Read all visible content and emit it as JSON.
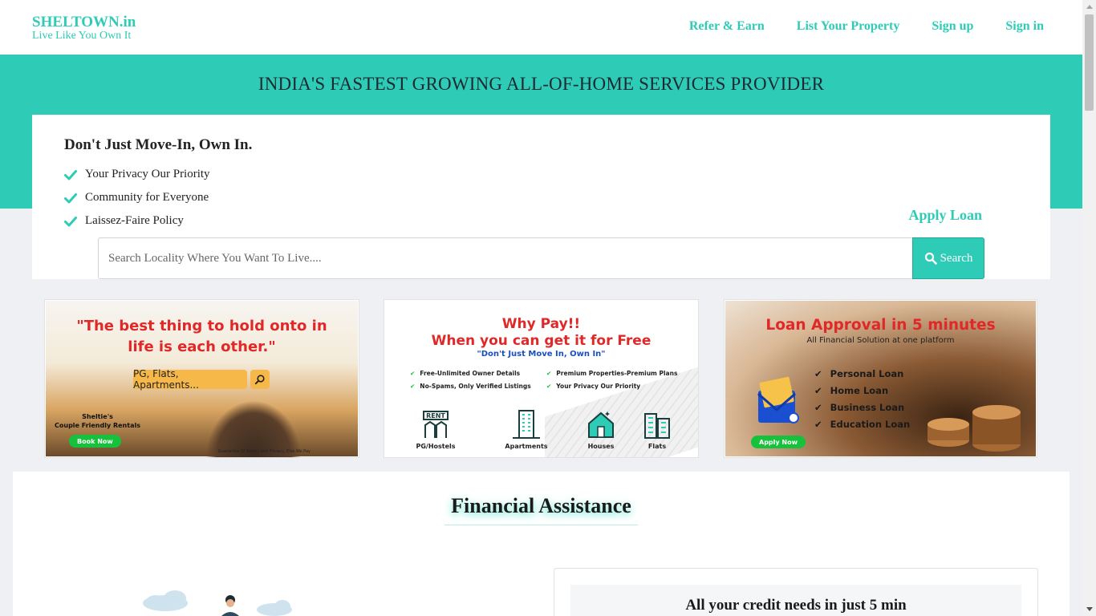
{
  "header": {
    "brand_name": "SHELTOWN.in",
    "brand_tagline": "Live Like You Own It",
    "nav": [
      "Refer & Earn",
      "List Your Property",
      "Sign up",
      "Sign in"
    ]
  },
  "band": {
    "title": "INDIA'S FASTEST GROWING ALL-OF-HOME SERVICES PROVIDER"
  },
  "hero": {
    "heading": "Don't Just Move-In, Own In.",
    "features": [
      "Your Privacy Our Priority",
      "Community for Everyone",
      "Laissez-Faire Policy"
    ],
    "apply_loan": "Apply Loan",
    "search_placeholder": "Search Locality Where You Want To Live....",
    "search_button": "Search"
  },
  "banners": {
    "couple": {
      "quote_line1": "\"The best thing to hold onto in",
      "quote_line2": "life is each other.\"",
      "pill": "PG, Flats, Apartments...",
      "small_line1": "Sheltie's",
      "small_line2": "Couple Friendly Rentals",
      "button": "Book Now",
      "fine_print": "Guarantee Of Safety and Privacy, Else We Pay"
    },
    "free": {
      "line1": "Why Pay!!",
      "line2": "When you can get it for Free",
      "sub": "\"Don't Just Move In, Own In\"",
      "left_features": [
        "Free-Unlimited Owner Details",
        "No-Spams, Only Verified Listings"
      ],
      "right_features": [
        "Premium Properties-Premium Plans",
        "Your Privacy Our Priority"
      ],
      "categories": [
        "PG/Hostels",
        "Apartments",
        "Houses",
        "Flats"
      ]
    },
    "loan": {
      "title": "Loan Approval in 5 minutes",
      "sub": "All Financial Solution at one platform",
      "items": [
        "Personal Loan",
        "Home Loan",
        "Business Loan",
        "Education Loan"
      ],
      "button": "Apply Now"
    }
  },
  "financial": {
    "title": "Financial Assistance",
    "card_title": "All your credit needs in just 5 min"
  },
  "colors": {
    "accent": "#2ecbb6",
    "headline_red": "#e02828",
    "cta_green": "#16c23b"
  }
}
